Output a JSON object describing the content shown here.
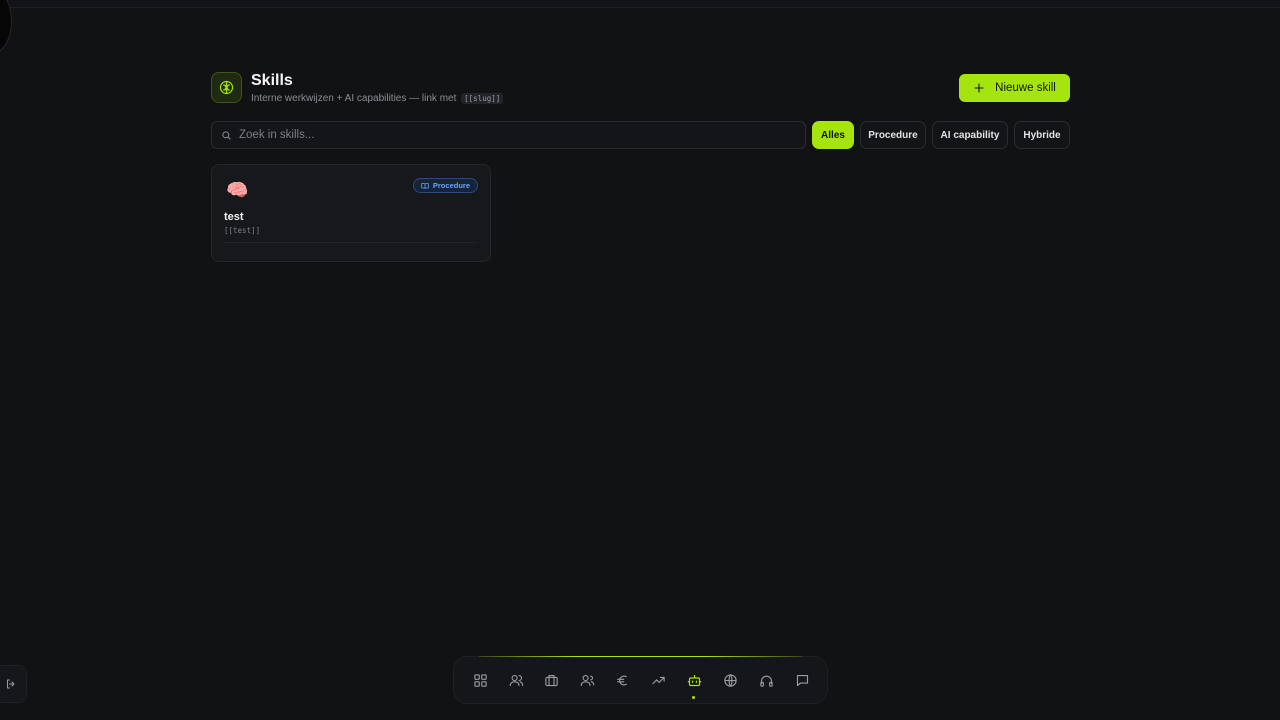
{
  "header": {
    "title": "Skills",
    "subtitle": "Interne werkwijzen + AI capabilities — link met",
    "subtitle_code": "[[slug]]",
    "new_button_label": "Nieuwe skill",
    "icon": "brain-icon"
  },
  "search": {
    "placeholder": "Zoek in skills...",
    "value": ""
  },
  "filters": [
    {
      "label": "Alles",
      "active": true
    },
    {
      "label": "Procedure",
      "active": false
    },
    {
      "label": "AI capability",
      "active": false
    },
    {
      "label": "Hybride",
      "active": false
    }
  ],
  "skills": [
    {
      "emoji": "🧠",
      "type_badge": "Procedure",
      "title": "test",
      "slug": "[[test]]"
    }
  ],
  "dock": {
    "items": [
      {
        "icon": "dashboard-icon",
        "active": false
      },
      {
        "icon": "users-icon",
        "active": false
      },
      {
        "icon": "briefcase-icon",
        "active": false
      },
      {
        "icon": "team-icon",
        "active": false
      },
      {
        "icon": "euro-icon",
        "active": false
      },
      {
        "icon": "trending-up-icon",
        "active": false
      },
      {
        "icon": "bot-icon",
        "active": true
      },
      {
        "icon": "globe-icon",
        "active": false
      },
      {
        "icon": "headphones-icon",
        "active": false
      },
      {
        "icon": "chat-icon",
        "active": false
      }
    ]
  },
  "colors": {
    "accent": "#a6e40f",
    "background": "#111214",
    "badge_blue": "#6ea3f5"
  }
}
